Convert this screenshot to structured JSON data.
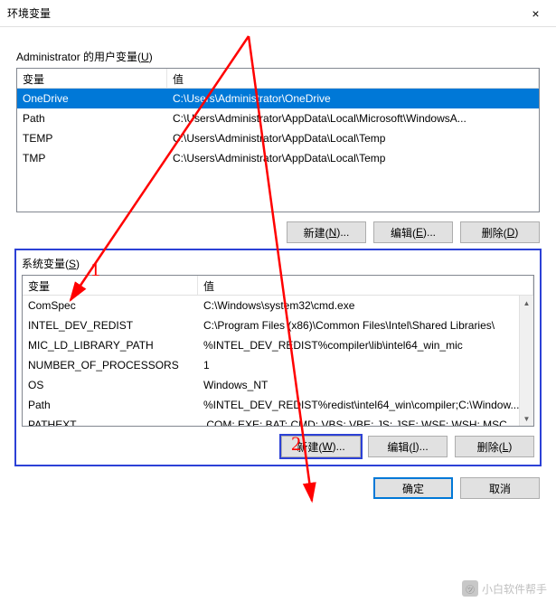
{
  "window": {
    "title": "环境变量",
    "close_icon": "×"
  },
  "user_section": {
    "label": "Administrator 的用户变量(",
    "label_key": "U",
    "label_end": ")",
    "headers": {
      "name": "变量",
      "value": "值"
    },
    "rows": [
      {
        "name": "OneDrive",
        "value": "C:\\Users\\Administrator\\OneDrive",
        "selected": true
      },
      {
        "name": "Path",
        "value": "C:\\Users\\Administrator\\AppData\\Local\\Microsoft\\WindowsA..."
      },
      {
        "name": "TEMP",
        "value": "C:\\Users\\Administrator\\AppData\\Local\\Temp"
      },
      {
        "name": "TMP",
        "value": "C:\\Users\\Administrator\\AppData\\Local\\Temp"
      }
    ],
    "buttons": {
      "new": {
        "text": "新建(",
        "key": "N",
        "end": ")..."
      },
      "edit": {
        "text": "编辑(",
        "key": "E",
        "end": ")..."
      },
      "delete": {
        "text": "删除(",
        "key": "D",
        "end": ")"
      }
    }
  },
  "sys_section": {
    "label": "系统变量(",
    "label_key": "S",
    "label_end": ")",
    "headers": {
      "name": "变量",
      "value": "值"
    },
    "rows": [
      {
        "name": "ComSpec",
        "value": "C:\\Windows\\system32\\cmd.exe"
      },
      {
        "name": "INTEL_DEV_REDIST",
        "value": "C:\\Program Files (x86)\\Common Files\\Intel\\Shared Libraries\\"
      },
      {
        "name": "MIC_LD_LIBRARY_PATH",
        "value": "%INTEL_DEV_REDIST%compiler\\lib\\intel64_win_mic"
      },
      {
        "name": "NUMBER_OF_PROCESSORS",
        "value": "1"
      },
      {
        "name": "OS",
        "value": "Windows_NT"
      },
      {
        "name": "Path",
        "value": "%INTEL_DEV_REDIST%redist\\intel64_win\\compiler;C:\\Window..."
      },
      {
        "name": "PATHEXT",
        "value": ".COM;.EXE;.BAT;.CMD;.VBS;.VBE;.JS;.JSE;.WSF;.WSH;.MSC"
      }
    ],
    "buttons": {
      "new": {
        "text": "新建(",
        "key": "W",
        "end": ")..."
      },
      "edit": {
        "text": "编辑(",
        "key": "I",
        "end": ")..."
      },
      "delete": {
        "text": "删除(",
        "key": "L",
        "end": ")"
      }
    }
  },
  "bottom": {
    "ok": "确定",
    "cancel": "取消"
  },
  "annotations": {
    "num1": "1",
    "num2": "2"
  },
  "watermark": "小白软件帮手"
}
